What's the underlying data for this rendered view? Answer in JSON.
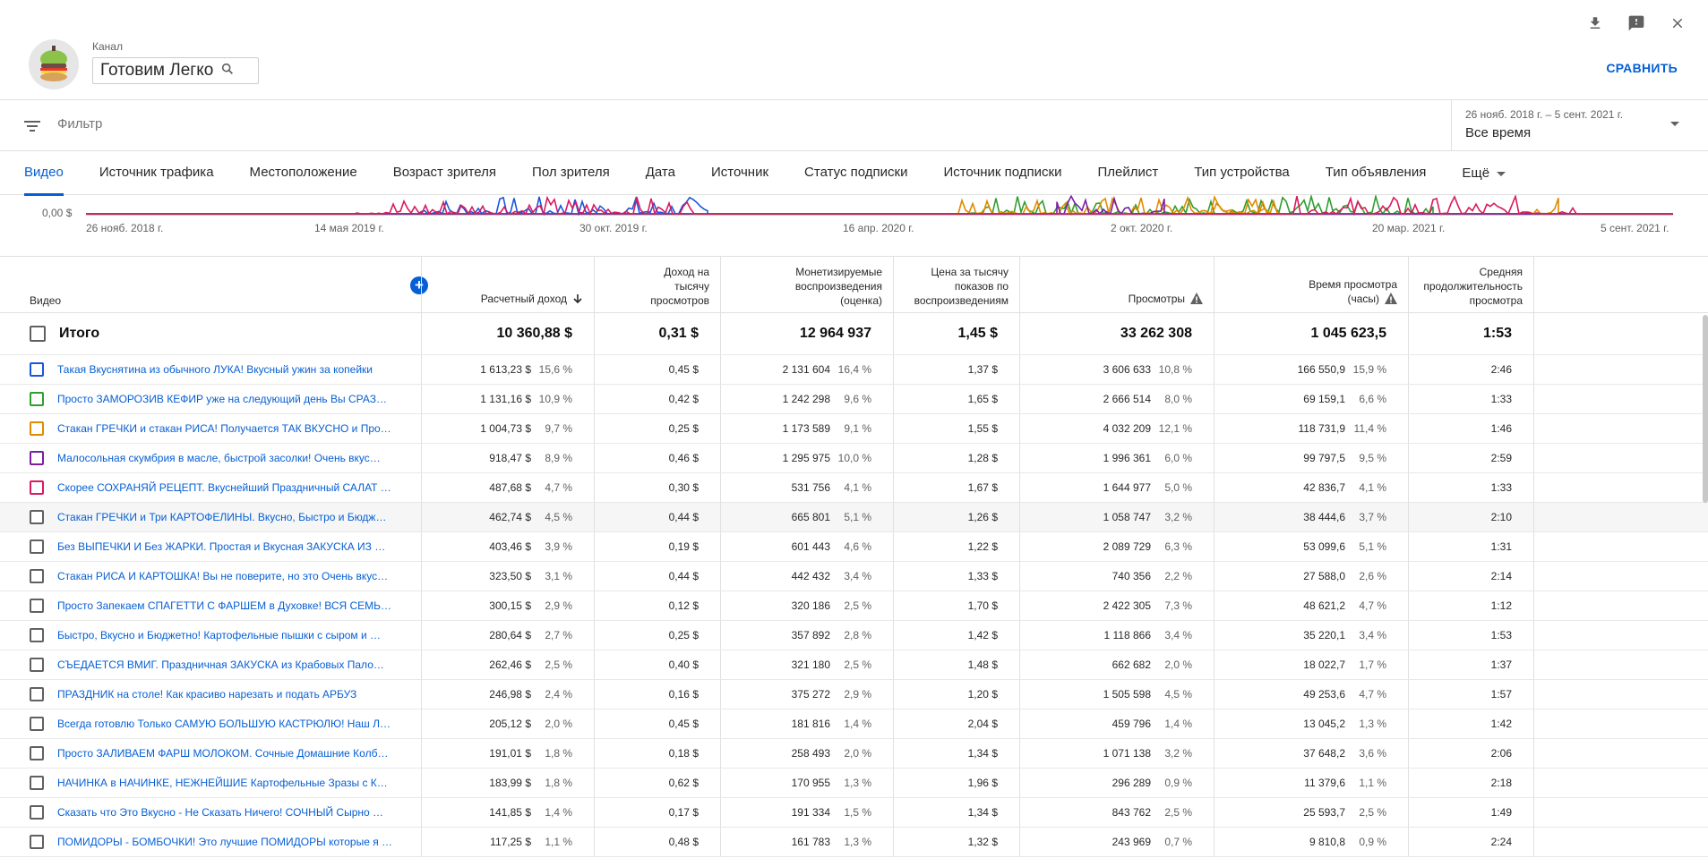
{
  "header": {
    "channel_label": "Канал",
    "channel_name": "Готовим Легко",
    "compare_label": "СРАВНИТЬ"
  },
  "icons": {
    "download": "download-icon",
    "feedback": "feedback-icon",
    "close": "close-icon",
    "search": "search-icon",
    "filter": "filter-icon"
  },
  "filter": {
    "placeholder": "Фильтр"
  },
  "date": {
    "range": "26 нояб. 2018 г. – 5 сент. 2021 г.",
    "period": "Все время"
  },
  "tabs": [
    {
      "label": "Видео",
      "active": true
    },
    {
      "label": "Источник трафика"
    },
    {
      "label": "Местоположение"
    },
    {
      "label": "Возраст зрителя"
    },
    {
      "label": "Пол зрителя"
    },
    {
      "label": "Дата"
    },
    {
      "label": "Источник"
    },
    {
      "label": "Статус подписки"
    },
    {
      "label": "Источник подписки"
    },
    {
      "label": "Плейлист"
    },
    {
      "label": "Тип устройства"
    },
    {
      "label": "Тип объявления"
    },
    {
      "label": "Ещё"
    }
  ],
  "chart_data": {
    "type": "line",
    "ylabel_tick": "0,00 $",
    "x_ticks": [
      "26 нояб. 2018 г.",
      "14 мая 2019 г.",
      "30 окт. 2019 г.",
      "16 апр. 2020 г.",
      "2 окт. 2020 г.",
      "20 мар. 2021 г.",
      "5 сент. 2021 г."
    ],
    "colors": [
      "#1a56db",
      "#2e9e2e",
      "#e08a00",
      "#7b1fa2",
      "#d81b60"
    ]
  },
  "table": {
    "headers": {
      "video": "Видео",
      "revenue": "Расчетный доход",
      "rpm": [
        "Доход на",
        "тысячу",
        "просмотров"
      ],
      "monetized": [
        "Монетизируемые",
        "воспроизведения",
        "(оценка)"
      ],
      "cpm": [
        "Цена за тысячу",
        "показов по",
        "воспроизведениям"
      ],
      "views": "Просмотры",
      "watch": [
        "Время просмотра",
        "(часы)"
      ],
      "avg": [
        "Средняя",
        "продолжительность",
        "просмотра"
      ]
    },
    "total": {
      "label": "Итого",
      "revenue": "10 360,88 $",
      "rpm": "0,31 $",
      "monetized": "12 964 937",
      "cpm": "1,45 $",
      "views": "33 262 308",
      "watch": "1 045 623,5",
      "avg": "1:53"
    },
    "rows": [
      {
        "title": "Такая Вкуснятина из обычного ЛУКА! Вкусный ужин за копейки",
        "cb": "#1a56db",
        "revenue": "1 613,23 $",
        "revenue_pct": "15,6 %",
        "rpm": "0,45 $",
        "monetized": "2 131 604",
        "monetized_pct": "16,4 %",
        "cpm": "1,37 $",
        "views": "3 606 633",
        "views_pct": "10,8 %",
        "watch": "166 550,9",
        "watch_pct": "15,9 %",
        "avg": "2:46"
      },
      {
        "title": "Просто ЗАМОРОЗИВ КЕФИР уже на следующий день Вы СРАЗ…",
        "cb": "#2e9e2e",
        "revenue": "1 131,16 $",
        "revenue_pct": "10,9 %",
        "rpm": "0,42 $",
        "monetized": "1 242 298",
        "monetized_pct": "9,6 %",
        "cpm": "1,65 $",
        "views": "2 666 514",
        "views_pct": "8,0 %",
        "watch": "69 159,1",
        "watch_pct": "6,6 %",
        "avg": "1:33"
      },
      {
        "title": "Стакан ГРЕЧКИ и стакан РИСА! Получается ТАК ВКУСНО и Про…",
        "cb": "#e08a00",
        "revenue": "1 004,73 $",
        "revenue_pct": "9,7 %",
        "rpm": "0,25 $",
        "monetized": "1 173 589",
        "monetized_pct": "9,1 %",
        "cpm": "1,55 $",
        "views": "4 032 209",
        "views_pct": "12,1 %",
        "watch": "118 731,9",
        "watch_pct": "11,4 %",
        "avg": "1:46"
      },
      {
        "title": "Малосольная скумбрия в масле, быстрой засолки! Очень вкус…",
        "cb": "#7b1fa2",
        "revenue": "918,47 $",
        "revenue_pct": "8,9 %",
        "rpm": "0,46 $",
        "monetized": "1 295 975",
        "monetized_pct": "10,0 %",
        "cpm": "1,28 $",
        "views": "1 996 361",
        "views_pct": "6,0 %",
        "watch": "99 797,5",
        "watch_pct": "9,5 %",
        "avg": "2:59"
      },
      {
        "title": "Скорее СОХРАНЯЙ РЕЦЕПТ. Вкуснейший Праздничный САЛАТ …",
        "cb": "#d81b60",
        "revenue": "487,68 $",
        "revenue_pct": "4,7 %",
        "rpm": "0,30 $",
        "monetized": "531 756",
        "monetized_pct": "4,1 %",
        "cpm": "1,67 $",
        "views": "1 644 977",
        "views_pct": "5,0 %",
        "watch": "42 836,7",
        "watch_pct": "4,1 %",
        "avg": "1:33"
      },
      {
        "title": "Стакан ГРЕЧКИ и Три КАРТОФЕЛИНЫ. Вкусно, Быстро и Бюдж…",
        "cb": "",
        "hl": true,
        "revenue": "462,74 $",
        "revenue_pct": "4,5 %",
        "rpm": "0,44 $",
        "monetized": "665 801",
        "monetized_pct": "5,1 %",
        "cpm": "1,26 $",
        "views": "1 058 747",
        "views_pct": "3,2 %",
        "watch": "38 444,6",
        "watch_pct": "3,7 %",
        "avg": "2:10"
      },
      {
        "title": "Без ВЫПЕЧКИ И Без ЖАРКИ. Простая и Вкусная ЗАКУСКА ИЗ …",
        "cb": "",
        "revenue": "403,46 $",
        "revenue_pct": "3,9 %",
        "rpm": "0,19 $",
        "monetized": "601 443",
        "monetized_pct": "4,6 %",
        "cpm": "1,22 $",
        "views": "2 089 729",
        "views_pct": "6,3 %",
        "watch": "53 099,6",
        "watch_pct": "5,1 %",
        "avg": "1:31"
      },
      {
        "title": "Стакан РИСА И КАРТОШКА! Вы не поверите, но это Очень вкус…",
        "cb": "",
        "revenue": "323,50 $",
        "revenue_pct": "3,1 %",
        "rpm": "0,44 $",
        "monetized": "442 432",
        "monetized_pct": "3,4 %",
        "cpm": "1,33 $",
        "views": "740 356",
        "views_pct": "2,2 %",
        "watch": "27 588,0",
        "watch_pct": "2,6 %",
        "avg": "2:14"
      },
      {
        "title": "Просто Запекаем СПАГЕТТИ С ФАРШЕМ в Духовке! ВСЯ СЕМЬ…",
        "cb": "",
        "revenue": "300,15 $",
        "revenue_pct": "2,9 %",
        "rpm": "0,12 $",
        "monetized": "320 186",
        "monetized_pct": "2,5 %",
        "cpm": "1,70 $",
        "views": "2 422 305",
        "views_pct": "7,3 %",
        "watch": "48 621,2",
        "watch_pct": "4,7 %",
        "avg": "1:12"
      },
      {
        "title": "Быстро, Вкусно и Бюджетно! Картофельные пышки с сыром и …",
        "cb": "",
        "revenue": "280,64 $",
        "revenue_pct": "2,7 %",
        "rpm": "0,25 $",
        "monetized": "357 892",
        "monetized_pct": "2,8 %",
        "cpm": "1,42 $",
        "views": "1 118 866",
        "views_pct": "3,4 %",
        "watch": "35 220,1",
        "watch_pct": "3,4 %",
        "avg": "1:53"
      },
      {
        "title": "СЪЕДАЕТСЯ ВМИГ. Праздничная ЗАКУСКА из Крабовых Пало…",
        "cb": "",
        "revenue": "262,46 $",
        "revenue_pct": "2,5 %",
        "rpm": "0,40 $",
        "monetized": "321 180",
        "monetized_pct": "2,5 %",
        "cpm": "1,48 $",
        "views": "662 682",
        "views_pct": "2,0 %",
        "watch": "18 022,7",
        "watch_pct": "1,7 %",
        "avg": "1:37"
      },
      {
        "title": "ПРАЗДНИК на столе! Как красиво нарезать и подать АРБУЗ",
        "cb": "",
        "revenue": "246,98 $",
        "revenue_pct": "2,4 %",
        "rpm": "0,16 $",
        "monetized": "375 272",
        "monetized_pct": "2,9 %",
        "cpm": "1,20 $",
        "views": "1 505 598",
        "views_pct": "4,5 %",
        "watch": "49 253,6",
        "watch_pct": "4,7 %",
        "avg": "1:57"
      },
      {
        "title": "Всегда готовлю Только САМУЮ БОЛЬШУЮ КАСТРЮЛЮ! Наш Л…",
        "cb": "",
        "revenue": "205,12 $",
        "revenue_pct": "2,0 %",
        "rpm": "0,45 $",
        "monetized": "181 816",
        "monetized_pct": "1,4 %",
        "cpm": "2,04 $",
        "views": "459 796",
        "views_pct": "1,4 %",
        "watch": "13 045,2",
        "watch_pct": "1,3 %",
        "avg": "1:42"
      },
      {
        "title": "Просто ЗАЛИВАЕМ ФАРШ МОЛОКОМ. Сочные Домашние Колб…",
        "cb": "",
        "revenue": "191,01 $",
        "revenue_pct": "1,8 %",
        "rpm": "0,18 $",
        "monetized": "258 493",
        "monetized_pct": "2,0 %",
        "cpm": "1,34 $",
        "views": "1 071 138",
        "views_pct": "3,2 %",
        "watch": "37 648,2",
        "watch_pct": "3,6 %",
        "avg": "2:06"
      },
      {
        "title": "НАЧИНКА в НАЧИНКЕ, НЕЖНЕЙШИЕ Картофельные Зразы с К…",
        "cb": "",
        "revenue": "183,99 $",
        "revenue_pct": "1,8 %",
        "rpm": "0,62 $",
        "monetized": "170 955",
        "monetized_pct": "1,3 %",
        "cpm": "1,96 $",
        "views": "296 289",
        "views_pct": "0,9 %",
        "watch": "11 379,6",
        "watch_pct": "1,1 %",
        "avg": "2:18"
      },
      {
        "title": "Сказать что Это Вкусно - Не Сказать Ничего! СОЧНЫЙ Сырно …",
        "cb": "",
        "revenue": "141,85 $",
        "revenue_pct": "1,4 %",
        "rpm": "0,17 $",
        "monetized": "191 334",
        "monetized_pct": "1,5 %",
        "cpm": "1,34 $",
        "views": "843 762",
        "views_pct": "2,5 %",
        "watch": "25 593,7",
        "watch_pct": "2,5 %",
        "avg": "1:49"
      },
      {
        "title": "ПОМИДОРЫ - БОМБОЧКИ! Это лучшие ПОМИДОРЫ которые я …",
        "cb": "",
        "revenue": "117,25 $",
        "revenue_pct": "1,1 %",
        "rpm": "0,48 $",
        "monetized": "161 783",
        "monetized_pct": "1,3 %",
        "cpm": "1,32 $",
        "views": "243 969",
        "views_pct": "0,7 %",
        "watch": "9 810,8",
        "watch_pct": "0,9 %",
        "avg": "2:24"
      }
    ]
  }
}
